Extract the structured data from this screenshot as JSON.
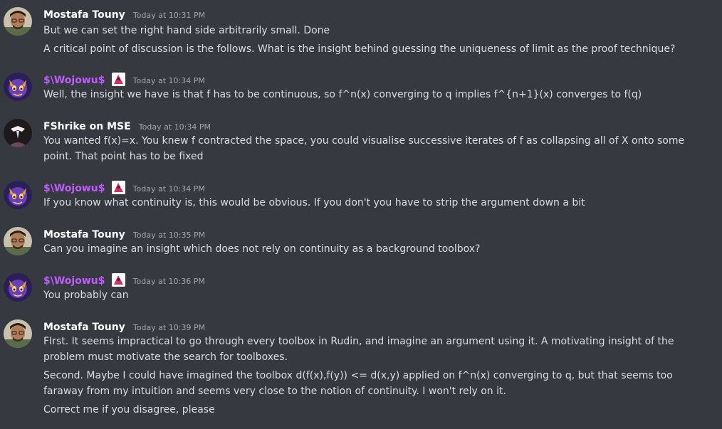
{
  "colors": {
    "background": "#36393f",
    "text": "#dcddde",
    "timestamp": "#a3a6aa",
    "username_default": "#ffffff",
    "username_role": "#c05bff"
  },
  "messages": [
    {
      "author": "Mostafa Touny",
      "timestamp": "Today at 10:31 PM",
      "avatar": "mostafa-avatar",
      "lines": [
        "But we can set the right hand side arbitrarily small. Done",
        "A critical point of discussion is the follows. What is the insight behind guessing the uniqueness of limit as the proof technique?"
      ]
    },
    {
      "author": "$\\Wojowu$",
      "timestamp": "Today at 10:34 PM",
      "avatar": "wojowu-avatar",
      "lines": [
        "Well, the insight we have is that f has to be continuous, so f^n(x) converging to q implies f^{n+1}(x) converges to f(q)"
      ]
    },
    {
      "author": "FShrike on MSE",
      "timestamp": "Today at 10:34 PM",
      "avatar": "fshrike-avatar",
      "lines": [
        "You wanted f(x)=x. You knew f contracted the space, you could visualise successive iterates of f as collapsing all of X onto some point. That point has to be fixed"
      ]
    },
    {
      "author": "$\\Wojowu$",
      "timestamp": "Today at 10:34 PM",
      "avatar": "wojowu-avatar",
      "lines": [
        "If you know what continuity is, this would be obvious. If you don't you have to strip the argument down a bit"
      ]
    },
    {
      "author": "Mostafa Touny",
      "timestamp": "Today at 10:35 PM",
      "avatar": "mostafa-avatar",
      "lines": [
        "Can you imagine an insight which does not rely on continuity as a background toolbox?"
      ]
    },
    {
      "author": "$\\Wojowu$",
      "timestamp": "Today at 10:36 PM",
      "avatar": "wojowu-avatar",
      "lines": [
        "You probably can"
      ]
    },
    {
      "author": "Mostafa Touny",
      "timestamp": "Today at 10:39 PM",
      "avatar": "mostafa-avatar",
      "lines": [
        "FIrst. It seems impractical to go through every toolbox in Rudin, and imagine an argument using it. A motivating insight of the problem must motivate the search for toolboxes.",
        "Second. Maybe I could have imagined the toolbox d(f(x),f(y)) <= d(x,y) applied on f^n(x) converging to q, but that seems too faraway from my intuition and seems very close to the notion of continuity. I won't rely on it.",
        "Correct me if you disagree, please"
      ]
    }
  ]
}
